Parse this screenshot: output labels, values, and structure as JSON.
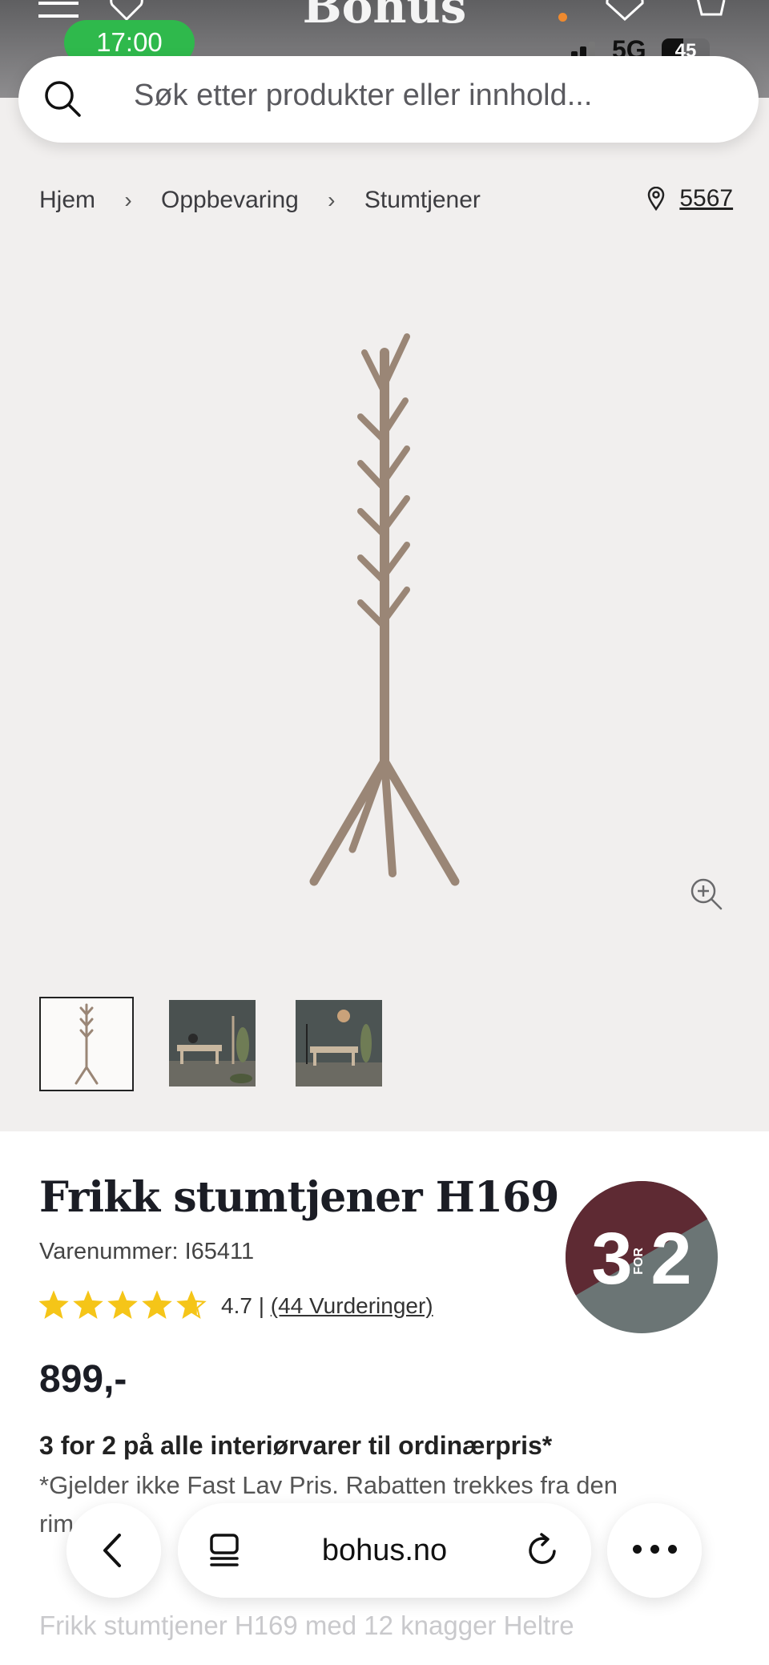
{
  "status_bar": {
    "time": "17:00",
    "network": "5G",
    "battery": "45",
    "battery_level": 0.45
  },
  "header": {
    "logo": "Bohus"
  },
  "search": {
    "placeholder": "Søk etter produkter eller innhold..."
  },
  "breadcrumb": {
    "items": [
      "Hjem",
      "Oppbevaring",
      "Stumtjener"
    ],
    "store_code": "5567"
  },
  "product": {
    "title": "Frikk stumtjener H169",
    "sku_label": "Varenummer: I65411",
    "rating_value": "4.7",
    "rating_separator": "|",
    "reviews_label": "(44 Vurderinger)",
    "rating": 4.7,
    "price": "899,-",
    "promo_heading": "3 for 2 på alle interiørvarer til ordinærpris*",
    "promo_text": "*Gjelder ikke Fast Lav Pris. Rabatten trekkes fra den",
    "promo_text_cont": "rim",
    "description_preview": "Frikk stumtjener H169 med 12 knagger Heltre"
  },
  "badge": {
    "big1": "3",
    "small": "FOR",
    "big2": "2",
    "color_top": "#5e2a33",
    "color_bottom": "#6b7575"
  },
  "browser": {
    "domain": "bohus.no"
  },
  "colors": {
    "status_green": "#2fb94c",
    "star": "#f5c518",
    "wood": "#9a8676"
  }
}
